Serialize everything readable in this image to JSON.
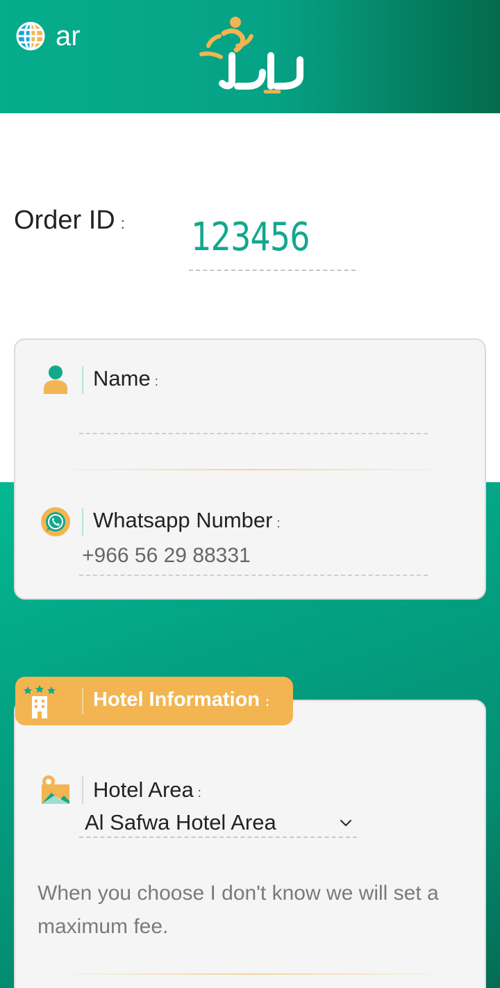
{
  "header": {
    "language_label": "ar",
    "logo_text": "راجل",
    "brand_colors": {
      "primary": "#05ad8c",
      "accent": "#f2b552"
    }
  },
  "order": {
    "label": "Order ID",
    "separator": ":",
    "value": "123456"
  },
  "contact_card": {
    "name_label": "Name",
    "name_value": "",
    "separator": ":",
    "whatsapp_label": "Whatsapp Number",
    "whatsapp_value": "+966 56 29 88331"
  },
  "hotel": {
    "section_title": "Hotel Information",
    "separator": ":",
    "area_label": "Hotel Area",
    "area_selected": "Al Safwa Hotel Area",
    "note": "When you choose I don't know we will set a maximum fee."
  },
  "icons": [
    "globe-icon",
    "logo",
    "user-icon",
    "whatsapp-icon",
    "hotel-icon",
    "map-pin-icon",
    "chevron-down-icon"
  ]
}
